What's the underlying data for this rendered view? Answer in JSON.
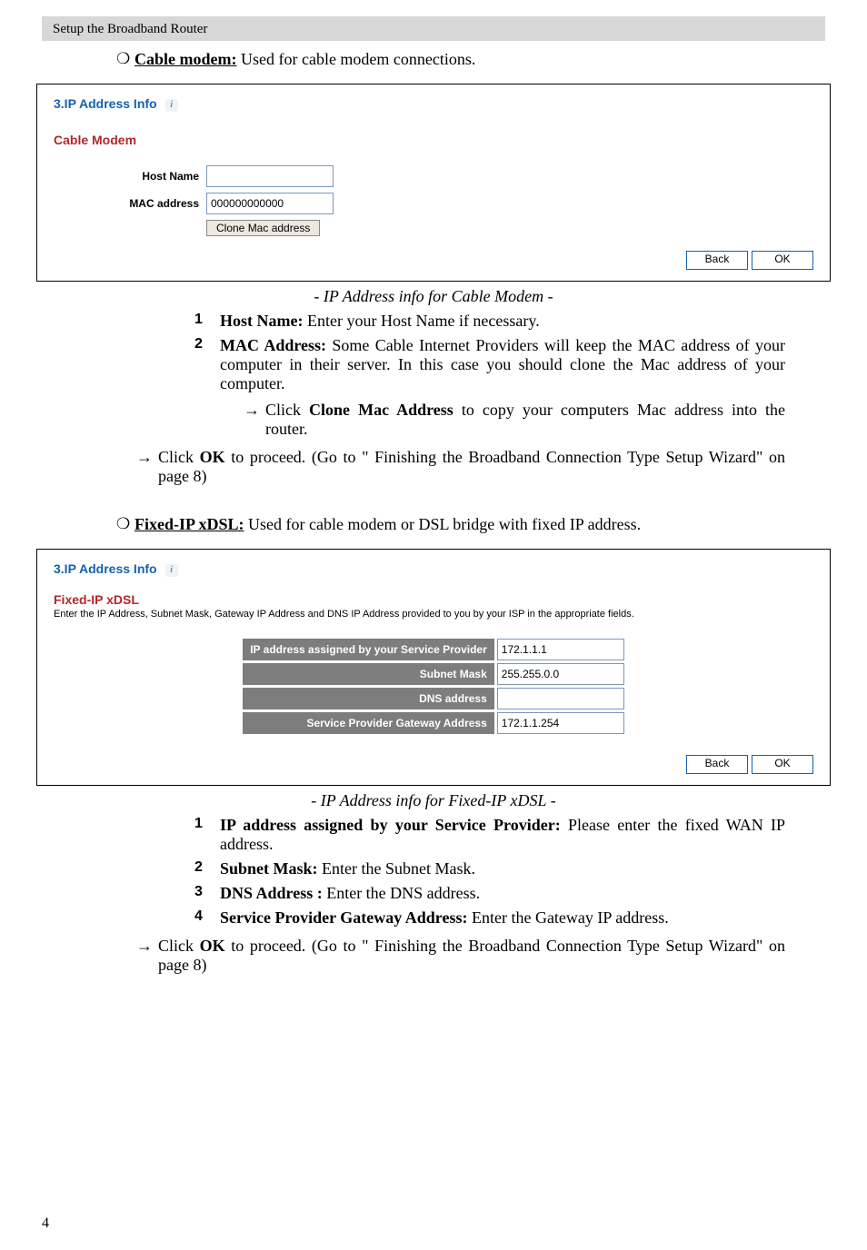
{
  "header": "Setup the Broadband Router",
  "page_number": "4",
  "intro_cable": {
    "bullet": "❍",
    "label": "Cable modem:",
    "text": " Used for cable modem connections."
  },
  "panel1": {
    "title": "3.IP Address Info",
    "subtitle": "Cable Modem",
    "host_label": "Host Name",
    "host_value": "",
    "mac_label": "MAC address",
    "mac_value": "000000000000",
    "clone_btn": "Clone Mac address",
    "back": "Back",
    "ok": "OK"
  },
  "caption1": "- IP Address info for Cable Modem -",
  "list1": [
    {
      "n": "1",
      "label": "Host Name:",
      "text": " Enter your Host Name if necessary."
    },
    {
      "n": "2",
      "label": "MAC Address:",
      "text": " Some Cable Internet Providers will keep the MAC address of your computer in their server. In this case you should clone the Mac address of your computer."
    }
  ],
  "clone_hint": {
    "arrow": "→",
    "pre": "Click ",
    "bold": "Clone Mac Address",
    "post": " to copy your computers Mac address into the router."
  },
  "ok_hint": {
    "arrow": "→",
    "pre": "Click ",
    "bold": "OK",
    "post": " to proceed. (Go to \" Finishing the Broadband Connection Type Setup Wizard\" on page 8)"
  },
  "intro_fixed": {
    "bullet": "❍",
    "label": "Fixed-IP xDSL:",
    "text": " Used for cable modem or DSL bridge with fixed IP address."
  },
  "panel2": {
    "title": "3.IP Address Info",
    "subtitle": "Fixed-IP xDSL",
    "desc": "Enter the IP Address, Subnet Mask, Gateway IP Address and DNS IP Address provided to you by your ISP in the appropriate fields.",
    "rows": {
      "ip_label": "IP address assigned by your Service Provider",
      "ip_value": "172.1.1.1",
      "mask_label": "Subnet Mask",
      "mask_value": "255.255.0.0",
      "dns_label": "DNS address",
      "dns_value": "",
      "gw_label": "Service Provider Gateway Address",
      "gw_value": "172.1.1.254"
    },
    "back": "Back",
    "ok": "OK"
  },
  "caption2": "- IP Address info for Fixed-IP xDSL -",
  "list2": [
    {
      "n": "1",
      "label": "IP address assigned by your Service Provider:",
      "text": " Please enter the fixed WAN IP address."
    },
    {
      "n": "2",
      "label": "Subnet Mask:",
      "text": " Enter the Subnet Mask."
    },
    {
      "n": "3",
      "label": "DNS Address :",
      "text": " Enter the DNS address."
    },
    {
      "n": "4",
      "label": "Service Provider Gateway Address:",
      "text": " Enter the Gateway IP address."
    }
  ],
  "ok_hint2": {
    "arrow": "→",
    "pre": "Click ",
    "bold": "OK",
    "post": " to proceed. (Go to \" Finishing the Broadband Connection Type Setup Wizard\" on page 8)"
  }
}
